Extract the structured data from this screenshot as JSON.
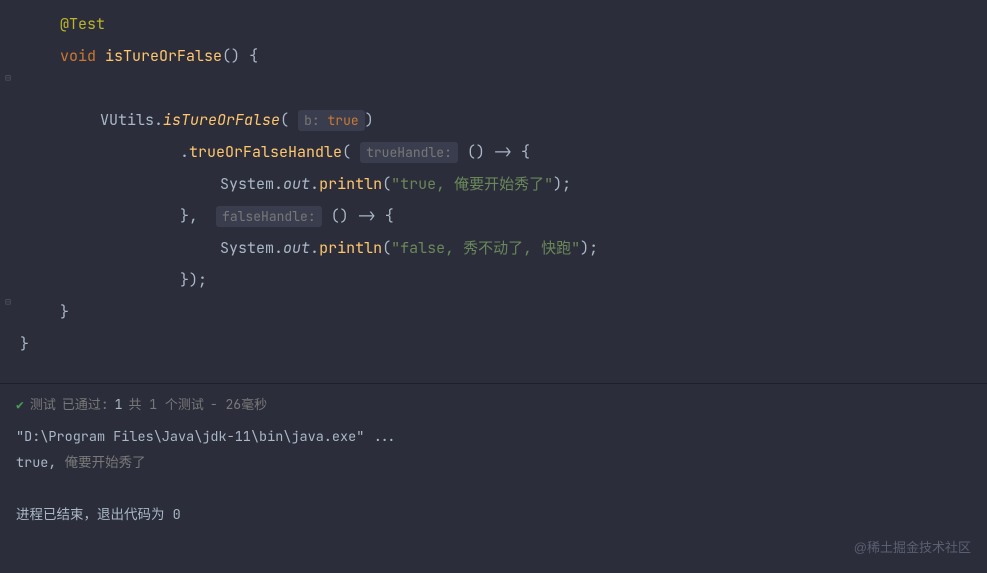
{
  "code": {
    "annotation": "@Test",
    "keyword_void": "void",
    "method_name": "isTureOrFalse",
    "parens_empty": "()",
    "brace_open": "{",
    "brace_close": "}",
    "class_VUtils": "VUtils",
    "method_isTureOrFalse": "isTureOrFalse",
    "hint_b": "b:",
    "keyword_true": "true",
    "method_trueOrFalseHandle": "trueOrFalseHandle",
    "hint_trueHandle": "trueHandle:",
    "hint_falseHandle": "falseHandle:",
    "arrow": "->",
    "System": "System",
    "out": "out",
    "println": "println",
    "string_true": "\"true, 俺要开始秀了\"",
    "string_false": "\"false, 秀不动了, 快跑\"",
    "comma": ",",
    "dot": ".",
    "paren_open": "(",
    "paren_close": ")",
    "semicolon": ";",
    "close_brace_paren": "});",
    "close_brace_comma": "},"
  },
  "console": {
    "status_label": "测试",
    "status_passed": "已通过:",
    "count_num": "1",
    "count_suffix": "共 1 个测试",
    "duration": "- 26毫秒",
    "java_path": "\"D:\\Program Files\\Java\\jdk-11\\bin\\java.exe\" ...",
    "output_prefix": "true,",
    "output_text": " 俺要开始秀了",
    "exit_line_prefix": "进程已结束，退出代码为 ",
    "exit_code": "0"
  },
  "watermark": "@稀土掘金技术社区"
}
